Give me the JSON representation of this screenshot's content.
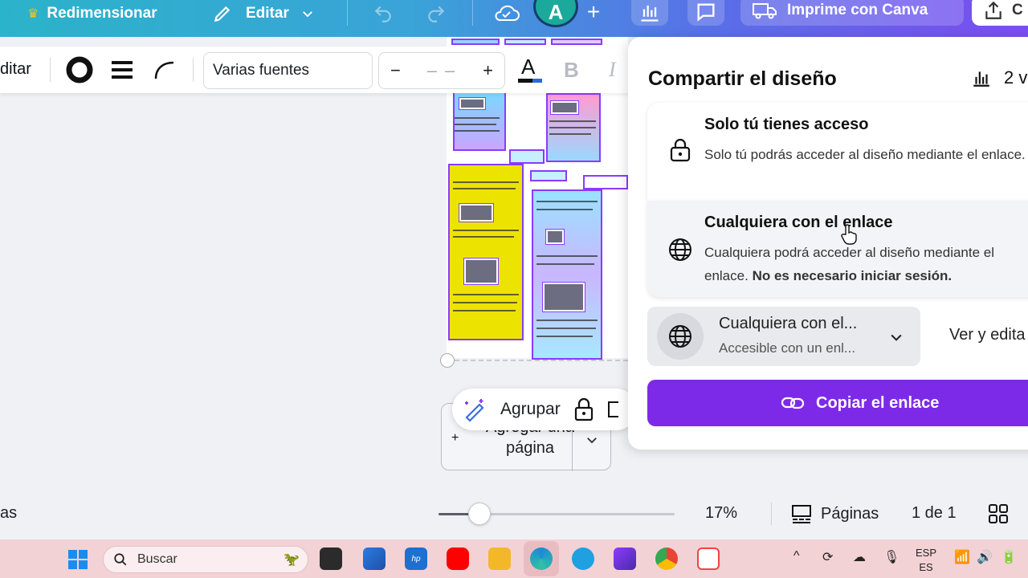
{
  "topbar": {
    "resize_label": "Redimensionar",
    "edit_label": "Editar",
    "avatar_initial": "A",
    "print_label": "Imprime con Canva"
  },
  "toolbar": {
    "edit_text": "ditar",
    "font_name": "Varias fuentes",
    "size_minus": "−",
    "size_value": "– –",
    "size_plus": "+",
    "bold": "B",
    "italic": "I"
  },
  "canvas": {
    "group_label": "Agrupar",
    "add_page_label": "página",
    "add_page_plus": "+",
    "add_page_partial": "Agregar una"
  },
  "share_panel": {
    "title": "Compartir el diseño",
    "stats_text": "2 v",
    "option_private": {
      "title": "Solo tú tienes acceso",
      "description": "Solo tú podrás acceder al diseño mediante el enlace."
    },
    "option_link": {
      "title": "Cualquiera con el enlace",
      "description": "Cualquiera podrá acceder al diseño mediante el enlace.",
      "note": "No es necesario iniciar sesión."
    },
    "access_select": {
      "value": "Cualquiera con el...",
      "subtitle": "Accesible con un enl..."
    },
    "permission": "Ver y edita",
    "copy_button": "Copiar el enlace"
  },
  "bottombar": {
    "notes_partial": "as",
    "zoom": "17%",
    "zoom_fraction": 0.17,
    "pages_label": "Páginas",
    "page_count": "1 de 1"
  },
  "taskbar": {
    "search_placeholder": "Buscar",
    "lang_top": "ESP",
    "lang_bottom": "ES"
  },
  "colors": {
    "accent": "#7d2ae8",
    "topbar_start": "#2bb3c9",
    "topbar_end": "#7b4df0",
    "taskbar": "#f3d2d6"
  }
}
